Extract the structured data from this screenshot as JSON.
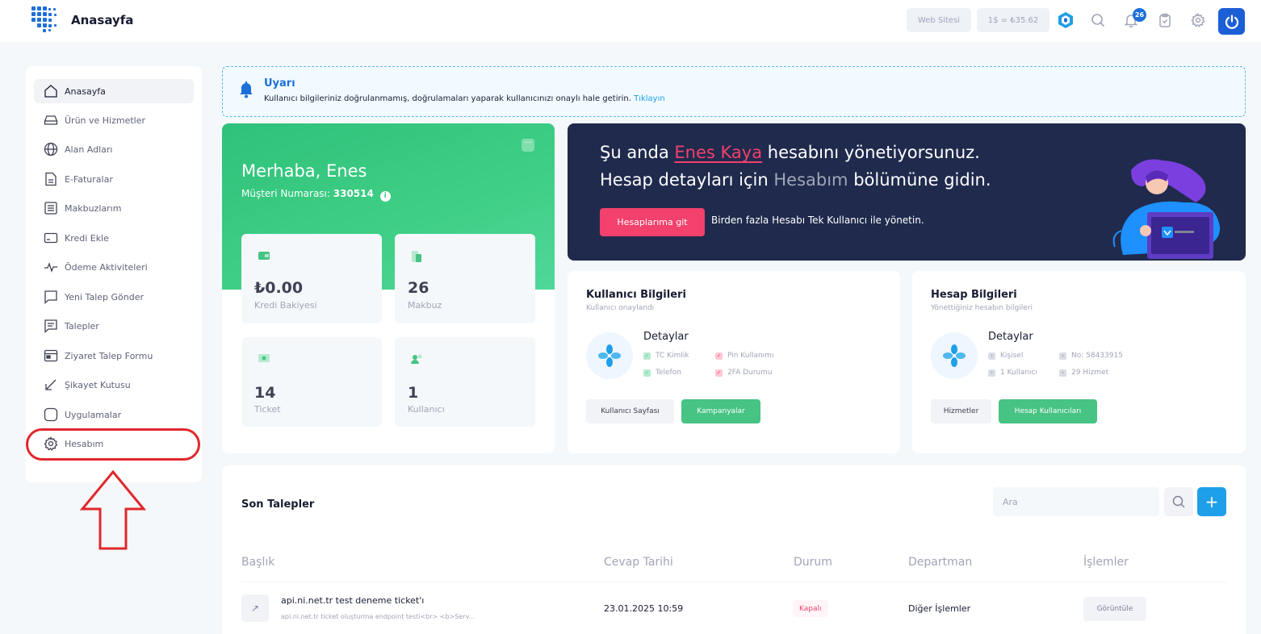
{
  "header": {
    "title": "Anasayfa",
    "website_label": "Web Sitesi",
    "currency_label": "1$ = ₺35.62",
    "notification_count": "26"
  },
  "sidebar": {
    "items": [
      {
        "label": "Anasayfa",
        "icon": "home-icon"
      },
      {
        "label": "Ürün ve Hizmetler",
        "icon": "server-icon"
      },
      {
        "label": "Alan Adları",
        "icon": "globe-icon"
      },
      {
        "label": "E-Faturalar",
        "icon": "invoice-icon"
      },
      {
        "label": "Makbuzlarım",
        "icon": "receipt-icon"
      },
      {
        "label": "Kredi Ekle",
        "icon": "credit-card-icon"
      },
      {
        "label": "Ödeme Aktiviteleri",
        "icon": "activity-icon"
      },
      {
        "label": "Yeni Talep Gönder",
        "icon": "message-icon"
      },
      {
        "label": "Talepler",
        "icon": "messages-icon"
      },
      {
        "label": "Ziyaret Talep Formu",
        "icon": "calendar-icon"
      },
      {
        "label": "Şikayet Kutusu",
        "icon": "arrow-down-left-icon"
      },
      {
        "label": "Uygulamalar",
        "icon": "app-square-icon"
      },
      {
        "label": "Hesabım",
        "icon": "gear-icon"
      }
    ]
  },
  "alert": {
    "title": "Uyarı",
    "text": "Kullanıcı bilgileriniz doğrulanmamış, doğrulamaları yaparak kullanıcınızı onaylı hale getirin.",
    "link": "Tıklayın"
  },
  "welcome": {
    "greeting": "Merhaba, Enes",
    "customer_label": "Müşteri Numarası:",
    "customer_no": "330514",
    "stats": [
      {
        "value": "₺0.00",
        "label": "Kredi Bakiyesi"
      },
      {
        "value": "26",
        "label": "Makbuz"
      },
      {
        "value": "14",
        "label": "Ticket"
      },
      {
        "value": "1",
        "label": "Kullanıcı"
      }
    ]
  },
  "banner": {
    "line1_pre": "Şu anda",
    "line1_name": "Enes Kaya",
    "line1_post": "hesabını yönetiyorsunuz.",
    "line2_pre": "Hesap detayları için",
    "line2_hl": "Hesabım",
    "line2_post": "bölümüne gidin.",
    "button": "Hesaplarıma git",
    "note": "Birden fazla Hesabı Tek Kullanıcı ile yönetin."
  },
  "user_info": {
    "title": "Kullanıcı Bilgileri",
    "subtitle": "Kullanıcı onaylandı",
    "details_title": "Detaylar",
    "items": [
      "TC Kimlik",
      "Pin Kullanımı",
      "Telefon",
      "2FA Durumu"
    ],
    "btn1": "Kullanıcı Sayfası",
    "btn2": "Kampanyalar"
  },
  "account_info": {
    "title": "Hesap Bilgileri",
    "subtitle": "Yönettiğiniz hesabın bilgileri",
    "details_title": "Detaylar",
    "items": [
      "Kişisel",
      "No: 58433915",
      "1 Kullanıcı",
      "29 Hizmet"
    ],
    "btn1": "Hizmetler",
    "btn2": "Hesap Kullanıcıları"
  },
  "tickets": {
    "title": "Son Talepler",
    "search_placeholder": "Ara",
    "columns": [
      "Başlık",
      "Cevap Tarihi",
      "Durum",
      "Departman",
      "İşlemler"
    ],
    "rows": [
      {
        "title": "api.ni.net.tr test deneme ticket'ı",
        "desc": "api.ni.net.tr ticket oluşturma endpoint testi<br> <b>Serv...",
        "date": "23.01.2025 10:59",
        "status": "Kapalı",
        "department": "Diğer İşlemler",
        "action": "Görüntüle"
      }
    ]
  },
  "colors": {
    "brand": "#1e6fd9",
    "green": "#3fcc84",
    "navy": "#1f2a4d",
    "pink": "#f1416c",
    "highlight": "#e0282e"
  }
}
